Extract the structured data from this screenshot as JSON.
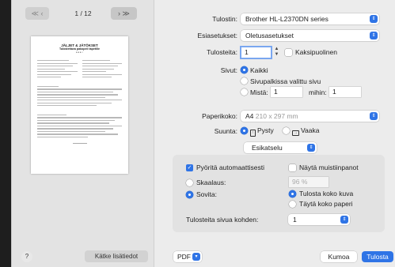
{
  "preview": {
    "prev_label": "≪ ‹",
    "next_label": "› ≫",
    "page_indicator": "1 / 12",
    "thumb_title1": "JÄLJET & JÄTÖKSET",
    "thumb_title2": "Tulostettava pakopeli tapetille",
    "details_button": "Kätke lisätiedot",
    "help_button": "?"
  },
  "form": {
    "printer_label": "Tulostin:",
    "printer_value": "Brother HL-L2370DN series",
    "presets_label": "Esiasetukset:",
    "presets_value": "Oletusasetukset",
    "copies_label": "Tulosteita:",
    "copies_value": "1",
    "duplex_label": "Kaksipuolinen",
    "pages_label": "Sivut:",
    "pages_all": "Kaikki",
    "pages_selected": "Sivupalkissa valittu sivu",
    "pages_from": "Mistä:",
    "pages_from_value": "1",
    "pages_to": "mihin:",
    "pages_to_value": "1",
    "paper_label": "Paperikoko:",
    "paper_value": "A4",
    "paper_dims": "210 x 297 mm",
    "orientation_label": "Suunta:",
    "orientation_portrait": "Pysty",
    "orientation_landscape": "Vaaka"
  },
  "section": {
    "selector_value": "Esikatselu",
    "auto_rotate": "Pyöritä automaattisesti",
    "show_notes": "Näytä muistiinpanot",
    "scale_label": "Skaalaus:",
    "scale_value": "96 %",
    "fit_label": "Sovita:",
    "print_entire": "Tulosta koko kuva",
    "fill_paper": "Täytä koko paperi",
    "copies_per_page_label": "Tulosteita sivua kohden:",
    "copies_per_page_value": "1"
  },
  "footer": {
    "pdf_label": "PDF",
    "cancel_label": "Kumoa",
    "print_label": "Tulosta"
  },
  "colors": {
    "accent": "#2f74e6"
  }
}
